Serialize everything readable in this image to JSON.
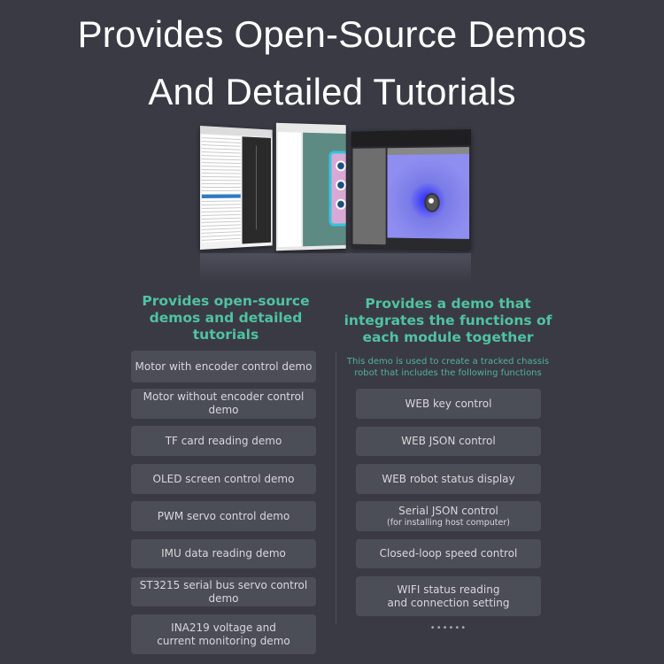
{
  "title": {
    "line1": "Provides Open-Source Demos",
    "line2": "And Detailed Tutorials"
  },
  "image": {
    "description": "Collage of three software screenshots: code/configuration editor, PCB layout viewer, and 3D robot simulator"
  },
  "left_column": {
    "heading": "Provides open-source demos and detailed tutorials",
    "items": [
      {
        "label": "Motor with encoder control demo"
      },
      {
        "label": "Motor without encoder control demo"
      },
      {
        "label": "TF card reading demo"
      },
      {
        "label": "OLED screen control demo"
      },
      {
        "label": "PWM servo control demo"
      },
      {
        "label": "IMU data reading demo"
      },
      {
        "label": "ST3215 serial bus servo control demo"
      },
      {
        "label": "INA219 voltage and",
        "label2": "current monitoring demo"
      }
    ]
  },
  "right_column": {
    "heading": "Provides a demo that integrates the functions of each module together",
    "description": "This demo is used to create a tracked chassis robot that includes the following functions",
    "items": [
      {
        "label": "WEB key control"
      },
      {
        "label": "WEB JSON control"
      },
      {
        "label": "WEB robot status display"
      },
      {
        "label": "Serial JSON control",
        "note": "(for installing host computer)"
      },
      {
        "label": "Closed-loop speed control"
      },
      {
        "label": "WIFI status reading",
        "label2": "and connection setting"
      }
    ],
    "more": "••••••"
  },
  "colors": {
    "background": "#3a3a45",
    "accent": "#4fc3a1",
    "box": "#4b4d57",
    "box_text": "#d8d8dc"
  }
}
